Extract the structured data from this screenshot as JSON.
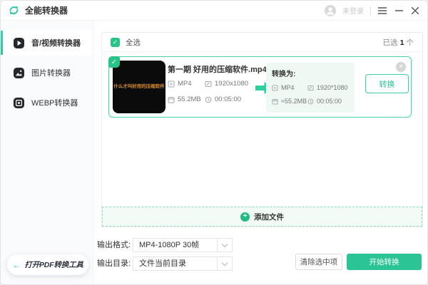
{
  "titlebar": {
    "app_name": "全能转换器",
    "login_label": "未登录",
    "accent_color": "#2bc596"
  },
  "sidebar": {
    "items": [
      {
        "label": "音/视频转换器",
        "icon": "video-icon",
        "active": true
      },
      {
        "label": "图片转换器",
        "icon": "image-icon",
        "active": false
      },
      {
        "label": "WEBP转换器",
        "icon": "webp-icon",
        "active": false
      }
    ],
    "pdf_tool_arrow": "←",
    "pdf_tool_label": "打开PDF转换工具"
  },
  "list_header": {
    "select_all_label": "全选",
    "checkbox_checked": "✓",
    "selected_prefix": "已选",
    "selected_count": "1",
    "selected_suffix": "个"
  },
  "file_card": {
    "badge_check": "✓",
    "thumbnail_text": "什么才叫好用的压缩软件",
    "name": "第一期 好用的压缩软件.mp4",
    "source": {
      "format": "MP4",
      "resolution": "1920x1080",
      "size": "55.2MB",
      "duration": "00:05:00"
    },
    "target_label": "转换为:",
    "target": {
      "format": "MP4",
      "resolution": "1920*1080",
      "size": "≈55.2MB",
      "duration": "00:05:00"
    },
    "convert_button_label": "转换",
    "close_glyph": "✕"
  },
  "add_files": {
    "plus_glyph": "+",
    "label": "添加文件"
  },
  "output": {
    "format_label": "输出格式:",
    "format_value": "MP4-1080P 30帧",
    "dir_label": "输出目录:",
    "dir_value": "文件当前目录"
  },
  "actions": {
    "clear_label": "清除选中项",
    "start_label": "开始转换"
  }
}
